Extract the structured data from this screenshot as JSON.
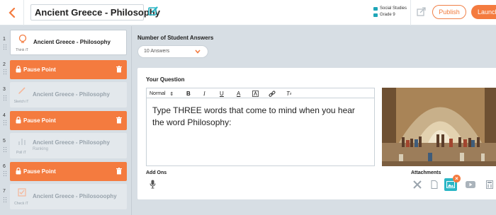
{
  "header": {
    "title": "Ancient Greece - Philosophy",
    "meta": {
      "subject": "Social Studies",
      "grade": "Grade 9"
    },
    "publish_label": "Publish",
    "launch_label": "Launch"
  },
  "colors": {
    "accent": "#f47b3f",
    "teal": "#2ab6c5",
    "subject_dot": "#1fa6b8"
  },
  "sidebar": {
    "items": [
      {
        "num": "1",
        "type": "slide",
        "title": "Ancient Greece - Philosophy",
        "label": "Think iT",
        "sub": "",
        "active": true
      },
      {
        "num": "2",
        "type": "pause",
        "title": "Pause Point"
      },
      {
        "num": "3",
        "type": "slide",
        "title": "Ancient Greece - Philosophy",
        "label": "Sketch iT",
        "sub": ""
      },
      {
        "num": "4",
        "type": "pause",
        "title": "Pause Point"
      },
      {
        "num": "5",
        "type": "slide",
        "title": "Ancient Greece - Philosophy",
        "label": "Poll iT",
        "sub": "Ranking"
      },
      {
        "num": "6",
        "type": "pause",
        "title": "Pause Point"
      },
      {
        "num": "7",
        "type": "slide",
        "title": "Ancient Greece - Philosooophy",
        "label": "Check iT",
        "sub": ""
      }
    ]
  },
  "main": {
    "num_answers_label": "Number of Student Answers",
    "num_answers_value": "10 Answers",
    "question_label": "Your Question",
    "toolbar": {
      "format": "Normal"
    },
    "question_text": "Type THREE words that come to mind when you hear the word Philosophy:",
    "addons_label": "Add Ons",
    "attachments_label": "Attachments"
  }
}
